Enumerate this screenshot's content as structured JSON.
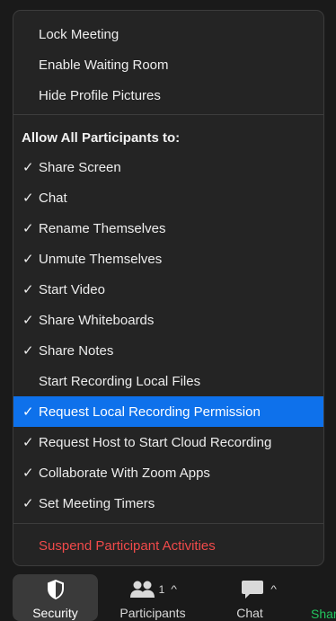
{
  "menu": {
    "top_items": [
      {
        "label": "Lock Meeting",
        "checked": false
      },
      {
        "label": "Enable Waiting Room",
        "checked": false
      },
      {
        "label": "Hide Profile Pictures",
        "checked": false
      }
    ],
    "section_header": "Allow All Participants to:",
    "check_glyph": "✓",
    "permissions": [
      {
        "label": "Share Screen",
        "checked": true
      },
      {
        "label": "Chat",
        "checked": true
      },
      {
        "label": "Rename Themselves",
        "checked": true
      },
      {
        "label": "Unmute Themselves",
        "checked": true
      },
      {
        "label": "Start Video",
        "checked": true
      },
      {
        "label": "Share Whiteboards",
        "checked": true
      },
      {
        "label": "Share Notes",
        "checked": true
      },
      {
        "label": "Start Recording Local Files",
        "checked": false
      },
      {
        "label": "Request Local Recording Permission",
        "checked": true,
        "highlighted": true
      },
      {
        "label": "Request Host to Start Cloud Recording",
        "checked": true
      },
      {
        "label": "Collaborate With Zoom Apps",
        "checked": true
      },
      {
        "label": "Set Meeting Timers",
        "checked": true
      }
    ],
    "suspend_label": "Suspend Participant Activities"
  },
  "toolbar": {
    "security_label": "Security",
    "participants_label": "Participants",
    "participants_count": "1",
    "chat_label": "Chat",
    "share_label": "Shar",
    "caret_glyph": "^"
  },
  "colors": {
    "highlight": "#0e71eb",
    "danger": "#f04a4a",
    "share_green": "#22c55e",
    "menu_bg": "#242424"
  }
}
